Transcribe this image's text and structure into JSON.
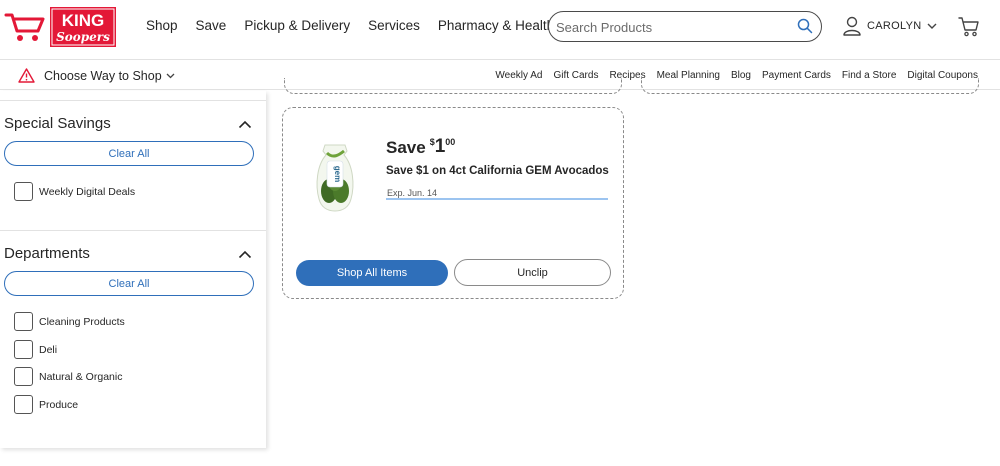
{
  "brand": {
    "logo_line1": "KING",
    "logo_line2": "Soopers",
    "accent_red": "#e31837",
    "accent_blue": "#2f6fba"
  },
  "header": {
    "nav": [
      "Shop",
      "Save",
      "Pickup & Delivery",
      "Services",
      "Pharmacy & Health"
    ],
    "search_placeholder": "Search Products",
    "search_icon": "search-icon",
    "user_name": "CAROLYN",
    "user_icon": "user-icon",
    "cart_icon": "cart-icon"
  },
  "subbar": {
    "choose_label": "Choose Way to Shop",
    "warning_icon": "warning-icon",
    "links": [
      "Weekly Ad",
      "Gift Cards",
      "Recipes",
      "Meal Planning",
      "Blog",
      "Payment Cards",
      "Find a Store",
      "Digital Coupons"
    ]
  },
  "sidebar": {
    "special_savings": {
      "heading": "Special Savings",
      "clear_label": "Clear All",
      "options": [
        "Weekly Digital Deals"
      ]
    },
    "departments": {
      "heading": "Departments",
      "clear_label": "Clear All",
      "options": [
        "Cleaning Products",
        "Deli",
        "Natural & Organic",
        "Produce"
      ]
    }
  },
  "coupon": {
    "save_word": "Save",
    "currency": "$",
    "amount": "1",
    "cents": "00",
    "description": "Save $1 on 4ct California GEM Avocados",
    "expiry": "Exp. Jun. 14",
    "product_brand": "gem",
    "shop_button": "Shop All Items",
    "unclip_button": "Unclip"
  }
}
